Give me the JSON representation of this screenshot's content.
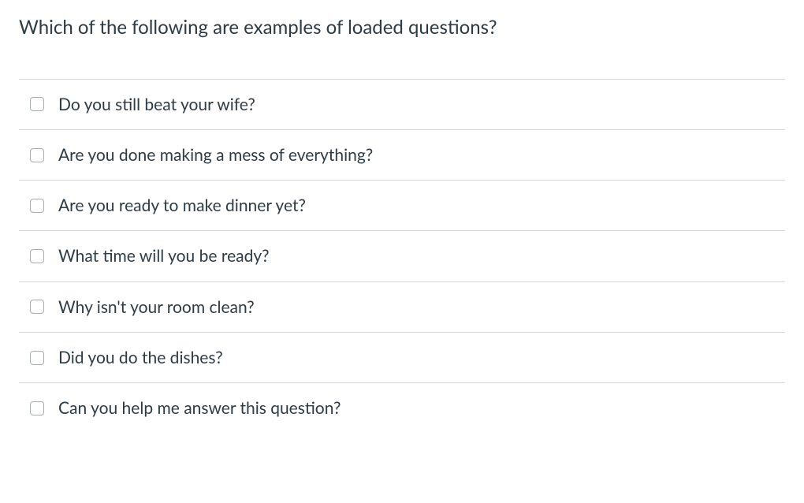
{
  "question": {
    "text": "Which of the following are examples of loaded questions?"
  },
  "options": [
    {
      "label": "Do you still beat your wife?"
    },
    {
      "label": "Are you done making a mess of everything?"
    },
    {
      "label": "Are you ready to make dinner yet?"
    },
    {
      "label": "What time will you be ready?"
    },
    {
      "label": "Why isn't your room clean?"
    },
    {
      "label": "Did you do the dishes?"
    },
    {
      "label": "Can you help me answer this question?"
    }
  ]
}
